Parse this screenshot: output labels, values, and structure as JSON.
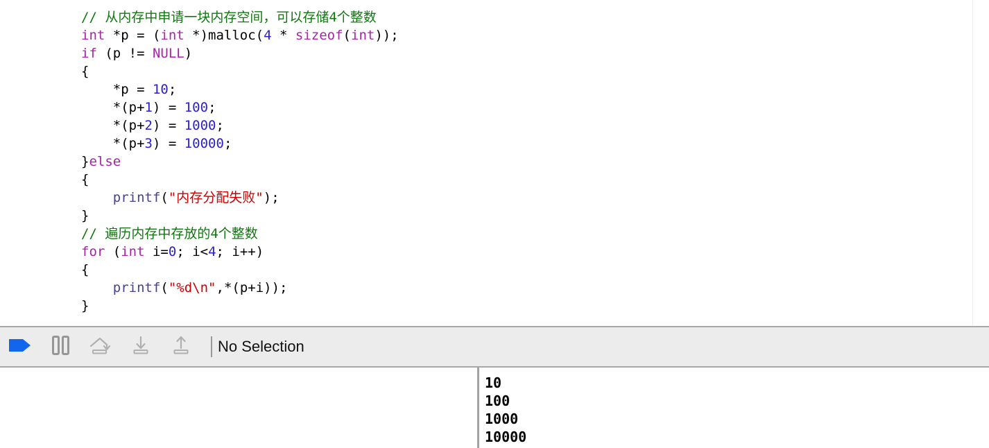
{
  "editor": {
    "language": "c",
    "lines": [
      [
        {
          "t": "// 从内存中申请一块内存空间，可以存储4个整数",
          "c": "comment"
        }
      ],
      [
        {
          "t": "int",
          "c": "kw"
        },
        {
          "t": " *p = (",
          "c": "plain"
        },
        {
          "t": "int",
          "c": "kw"
        },
        {
          "t": " *)malloc(",
          "c": "plain"
        },
        {
          "t": "4",
          "c": "num"
        },
        {
          "t": " * ",
          "c": "plain"
        },
        {
          "t": "sizeof",
          "c": "kw"
        },
        {
          "t": "(",
          "c": "plain"
        },
        {
          "t": "int",
          "c": "kw"
        },
        {
          "t": "));",
          "c": "plain"
        }
      ],
      [
        {
          "t": "if",
          "c": "kw"
        },
        {
          "t": " (p != ",
          "c": "plain"
        },
        {
          "t": "NULL",
          "c": "kw"
        },
        {
          "t": ")",
          "c": "plain"
        }
      ],
      [
        {
          "t": "{",
          "c": "plain"
        }
      ],
      [
        {
          "t": "    *p = ",
          "c": "plain"
        },
        {
          "t": "10",
          "c": "num"
        },
        {
          "t": ";",
          "c": "plain"
        }
      ],
      [
        {
          "t": "    *(p+",
          "c": "plain"
        },
        {
          "t": "1",
          "c": "num"
        },
        {
          "t": ") = ",
          "c": "plain"
        },
        {
          "t": "100",
          "c": "num"
        },
        {
          "t": ";",
          "c": "plain"
        }
      ],
      [
        {
          "t": "    *(p+",
          "c": "plain"
        },
        {
          "t": "2",
          "c": "num"
        },
        {
          "t": ") = ",
          "c": "plain"
        },
        {
          "t": "1000",
          "c": "num"
        },
        {
          "t": ";",
          "c": "plain"
        }
      ],
      [
        {
          "t": "    *(p+",
          "c": "plain"
        },
        {
          "t": "3",
          "c": "num"
        },
        {
          "t": ") = ",
          "c": "plain"
        },
        {
          "t": "10000",
          "c": "num"
        },
        {
          "t": ";",
          "c": "plain"
        }
      ],
      [
        {
          "t": "}",
          "c": "plain"
        },
        {
          "t": "else",
          "c": "kw"
        }
      ],
      [
        {
          "t": "{",
          "c": "plain"
        }
      ],
      [
        {
          "t": "    ",
          "c": "plain"
        },
        {
          "t": "printf",
          "c": "fn"
        },
        {
          "t": "(",
          "c": "plain"
        },
        {
          "t": "\"内存分配失败\"",
          "c": "str"
        },
        {
          "t": ");",
          "c": "plain"
        }
      ],
      [
        {
          "t": "}",
          "c": "plain"
        }
      ],
      [
        {
          "t": "// 遍历内存中存放的4个整数",
          "c": "comment"
        }
      ],
      [
        {
          "t": "for",
          "c": "kw"
        },
        {
          "t": " (",
          "c": "plain"
        },
        {
          "t": "int",
          "c": "kw"
        },
        {
          "t": " i=",
          "c": "plain"
        },
        {
          "t": "0",
          "c": "num"
        },
        {
          "t": "; i<",
          "c": "plain"
        },
        {
          "t": "4",
          "c": "num"
        },
        {
          "t": "; i++)",
          "c": "plain"
        }
      ],
      [
        {
          "t": "{",
          "c": "plain"
        }
      ],
      [
        {
          "t": "    ",
          "c": "plain"
        },
        {
          "t": "printf",
          "c": "fn"
        },
        {
          "t": "(",
          "c": "plain"
        },
        {
          "t": "\"%d\\n\"",
          "c": "str"
        },
        {
          "t": ",*(p+i));",
          "c": "plain"
        }
      ],
      [
        {
          "t": "}",
          "c": "plain"
        }
      ]
    ]
  },
  "debug_bar": {
    "buttons": [
      {
        "name": "continue-execution-button",
        "icon": "continue-arrow-icon",
        "label": "Continue program execution",
        "state": "enabled",
        "color": "#1266ee"
      },
      {
        "name": "pause-button",
        "icon": "pause-icon",
        "label": "Pause",
        "state": "disabled",
        "color": "#969696"
      },
      {
        "name": "step-over-button",
        "icon": "step-over-icon",
        "label": "Step over",
        "state": "disabled",
        "color": "#b0b0b0"
      },
      {
        "name": "step-into-button",
        "icon": "step-into-icon",
        "label": "Step into",
        "state": "disabled",
        "color": "#b0b0b0"
      },
      {
        "name": "step-out-button",
        "icon": "step-out-icon",
        "label": "Step out",
        "state": "disabled",
        "color": "#b0b0b0"
      }
    ],
    "selection_text": "No Selection"
  },
  "console": {
    "lines": [
      "10",
      "100",
      "1000",
      "10000"
    ]
  },
  "colors": {
    "comment": "#117711",
    "keyword": "#aa22aa",
    "number": "#2a1fd0",
    "string": "#cc0000",
    "function": "#46409a",
    "bar_background": "#ececec",
    "bar_border": "#a8a8a8",
    "accent": "#1266ee"
  }
}
